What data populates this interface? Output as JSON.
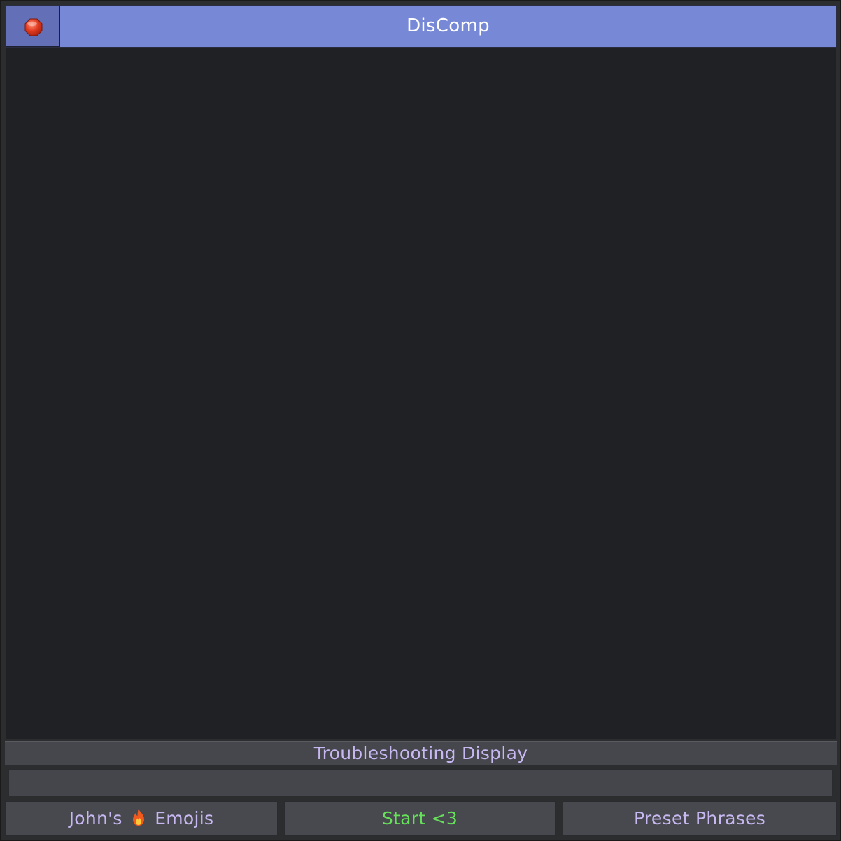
{
  "window": {
    "title": "DisComp",
    "close_icon": "stop-sign-icon"
  },
  "troubleshooting": {
    "label": "Troubleshooting Display",
    "value": ""
  },
  "buttons": {
    "emojis_prefix": "John's",
    "emojis_icon": "fire-icon",
    "emojis_suffix": "Emojis",
    "start": "Start <3",
    "preset": "Preset Phrases"
  },
  "colors": {
    "titlebar": "#7788d6",
    "canvas": "#202125",
    "label_text": "#c7b8f2",
    "start_text": "#66e05a"
  }
}
